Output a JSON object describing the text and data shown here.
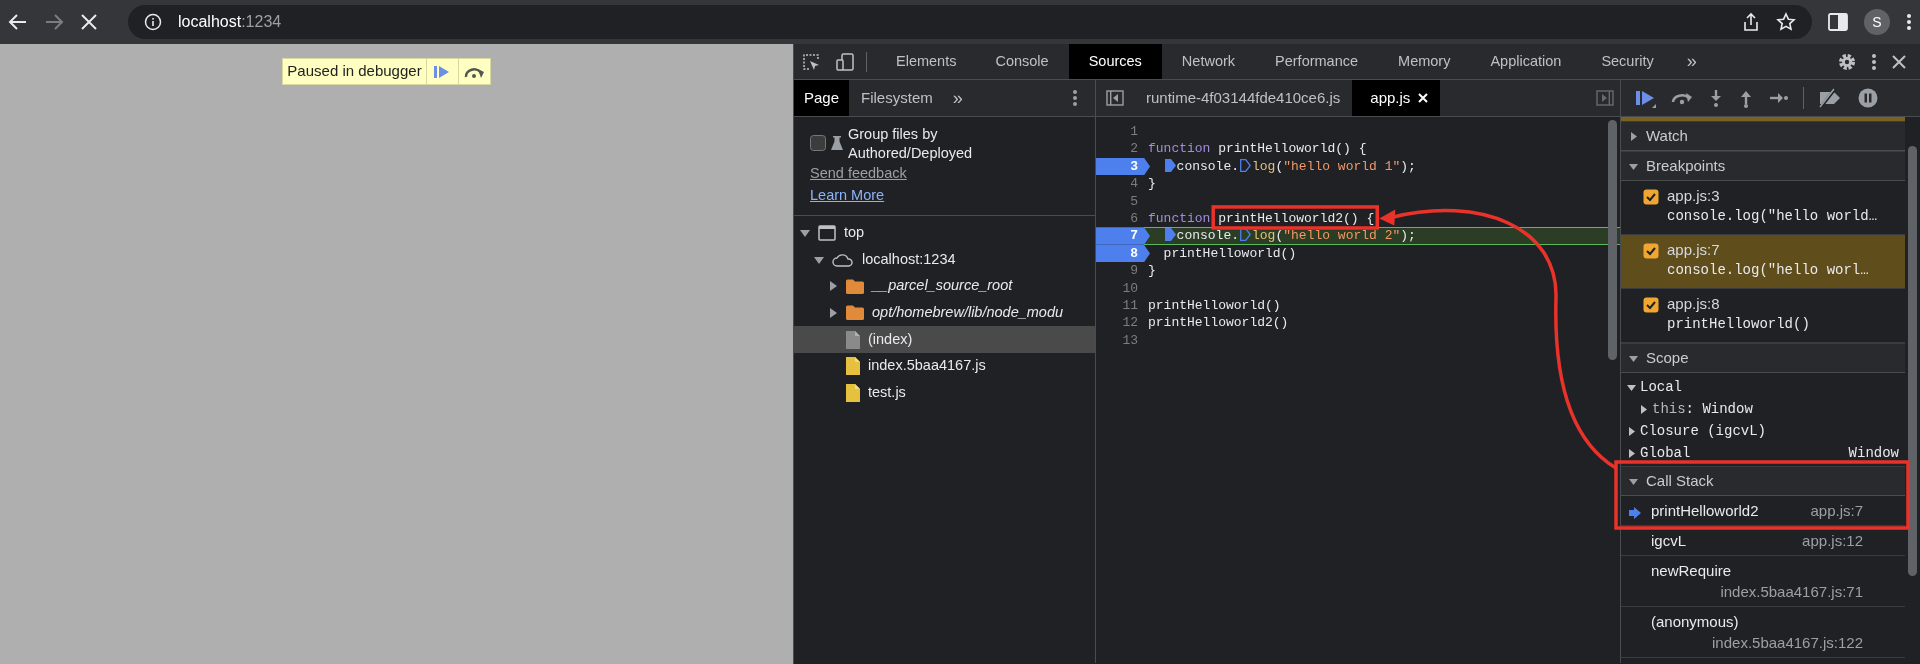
{
  "browser": {
    "host": "localhost",
    "port": ":1234",
    "loading": true,
    "profile_initial": "S"
  },
  "page": {
    "paused_message": "Paused in debugger"
  },
  "devtools": {
    "tabs": [
      {
        "label": "Elements",
        "selected": false
      },
      {
        "label": "Console",
        "selected": false
      },
      {
        "label": "Sources",
        "selected": true
      },
      {
        "label": "Network",
        "selected": false
      },
      {
        "label": "Performance",
        "selected": false
      },
      {
        "label": "Memory",
        "selected": false
      },
      {
        "label": "Application",
        "selected": false
      },
      {
        "label": "Security",
        "selected": false
      }
    ],
    "more_tabs": "»"
  },
  "navigator": {
    "tabs": [
      {
        "label": "Page",
        "selected": true
      },
      {
        "label": "Filesystem",
        "selected": false
      }
    ],
    "more_tabs": "»",
    "group_option": {
      "label": "Group files by Authored/Deployed",
      "checked": false
    },
    "links": [
      "Send feedback",
      "Learn More"
    ],
    "tree": [
      {
        "label": "top",
        "kind": "frame",
        "expanded": true,
        "selected": false,
        "children": [
          {
            "label": "localhost:1234",
            "kind": "domain",
            "expanded": true,
            "selected": false,
            "children": [
              {
                "label": "__parcel_source_root",
                "kind": "folder",
                "expanded": false,
                "selected": false
              },
              {
                "label": "opt/homebrew/lib/node_modu",
                "kind": "folder",
                "expanded": false,
                "selected": false
              },
              {
                "label": "(index)",
                "kind": "document",
                "selected": true
              },
              {
                "label": "index.5baa4167.js",
                "kind": "script",
                "selected": false
              },
              {
                "label": "test.js",
                "kind": "script",
                "selected": false
              }
            ]
          }
        ]
      }
    ]
  },
  "editor": {
    "tabs": [
      {
        "label": "runtime-4f03144fde410ce6.js",
        "selected": false,
        "closable": false
      },
      {
        "label": "app.js",
        "selected": true,
        "closable": true
      }
    ],
    "lines": [
      {
        "number": "1",
        "breakpoint": false,
        "current": false
      },
      {
        "number": "2",
        "breakpoint": false,
        "current": false,
        "segments": [
          {
            "kind": "keyword",
            "text": "function"
          },
          {
            "kind": "plain",
            "text": "printHelloworld() {"
          }
        ]
      },
      {
        "number": "3",
        "breakpoint": true,
        "current": false,
        "indented": true,
        "segments": [
          {
            "kind": "stop",
            "filled": true
          },
          {
            "kind": "plain",
            "text": "console."
          },
          {
            "kind": "stop",
            "filled": false
          },
          {
            "kind": "method",
            "text": "log"
          },
          {
            "kind": "plain",
            "text": "("
          },
          {
            "kind": "string",
            "text": "\"hello world 1\""
          },
          {
            "kind": "plain",
            "text": ");"
          }
        ]
      },
      {
        "number": "4",
        "breakpoint": false,
        "current": false,
        "segments": [
          {
            "kind": "plain",
            "text": "}"
          }
        ]
      },
      {
        "number": "5",
        "breakpoint": false,
        "current": false
      },
      {
        "number": "6",
        "breakpoint": false,
        "current": false,
        "segments": [
          {
            "kind": "keyword",
            "text": "function"
          },
          {
            "kind": "plain",
            "text": "printHelloworld2() {",
            "outlined": true
          }
        ]
      },
      {
        "number": "7",
        "breakpoint": true,
        "current": true,
        "indented": true,
        "segments": [
          {
            "kind": "stop",
            "filled": true
          },
          {
            "kind": "plain",
            "text": "console."
          },
          {
            "kind": "stop",
            "filled": false
          },
          {
            "kind": "method",
            "text": "log"
          },
          {
            "kind": "plain",
            "text": "("
          },
          {
            "kind": "string",
            "text": "\"hello world 2\""
          },
          {
            "kind": "plain",
            "text": ");"
          }
        ]
      },
      {
        "number": "8",
        "breakpoint": true,
        "current": false,
        "indented": true,
        "segments": [
          {
            "kind": "plain",
            "text": "printHelloworld()"
          }
        ]
      },
      {
        "number": "9",
        "breakpoint": false,
        "current": false,
        "segments": [
          {
            "kind": "plain",
            "text": "}"
          }
        ]
      },
      {
        "number": "10",
        "breakpoint": false,
        "current": false
      },
      {
        "number": "11",
        "breakpoint": false,
        "current": false,
        "segments": [
          {
            "kind": "plain",
            "text": "printHelloworld()"
          }
        ]
      },
      {
        "number": "12",
        "breakpoint": false,
        "current": false,
        "segments": [
          {
            "kind": "plain",
            "text": "printHelloworld2()"
          }
        ]
      },
      {
        "number": "13",
        "breakpoint": false,
        "current": false
      }
    ]
  },
  "debugger": {
    "watch": {
      "title": "Watch",
      "expanded": false
    },
    "breakpoints": {
      "title": "Breakpoints",
      "expanded": true,
      "items": [
        {
          "location": "app.js:3",
          "code": "console.log(\"hello world…",
          "checked": true,
          "selected": false
        },
        {
          "location": "app.js:7",
          "code": "console.log(\"hello worl…",
          "checked": true,
          "selected": true
        },
        {
          "location": "app.js:8",
          "code": "printHelloworld()",
          "checked": true,
          "selected": false
        }
      ]
    },
    "scope": {
      "title": "Scope",
      "expanded": true,
      "entries": [
        {
          "kind": "scope",
          "name": "Local",
          "expanded": true,
          "children": [
            {
              "kind": "property",
              "name": "this",
              "separator": ":",
              "value": "Window",
              "expanded": false
            }
          ]
        },
        {
          "kind": "scope",
          "name": "Closure (igcvL)",
          "expanded": false
        },
        {
          "kind": "scope",
          "name": "Global",
          "value": "Window",
          "expanded": false
        }
      ]
    },
    "call_stack": {
      "title": "Call Stack",
      "expanded": true,
      "outlined": true,
      "frames": [
        {
          "function": "printHelloworld2",
          "location": "app.js:7",
          "selected": true
        },
        {
          "function": "igcvL",
          "location": "app.js:12",
          "selected": false
        },
        {
          "function": "newRequire",
          "location": "index.5baa4167.js:71",
          "selected": false
        },
        {
          "function": "(anonymous)",
          "location": "index.5baa4167.js:122",
          "selected": false
        }
      ]
    }
  }
}
